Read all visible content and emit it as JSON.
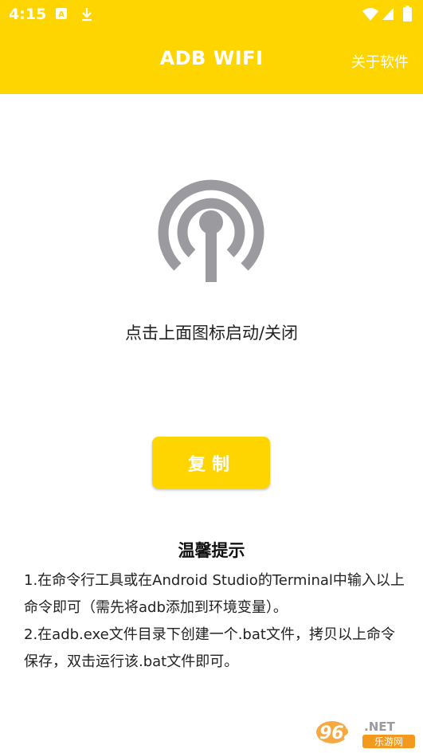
{
  "status_bar": {
    "time": "4:15",
    "icons": [
      "a-notification-icon",
      "download-icon",
      "wifi-icon",
      "signal-icon",
      "battery-icon"
    ]
  },
  "app_bar": {
    "title": "ADB WIFI",
    "action_label": "关于软件",
    "background": "#FFD500"
  },
  "main": {
    "toggle_icon": "wifi-tower-icon",
    "toggle_hint": "点击上面图标启动/关闭",
    "copy_button_label": "复制"
  },
  "tips": {
    "title": "温馨提示",
    "items": [
      "1.在命令行工具或在Android Studio的Terminal中输入以上命令即可（需先将adb添加到环境变量）。",
      "2.在adb.exe文件目录下创建一个.bat文件，拷贝以上命令保存，双击运行该.bat文件即可。"
    ]
  },
  "watermark": {
    "text": "962.NET",
    "subtext": "乐游网"
  }
}
